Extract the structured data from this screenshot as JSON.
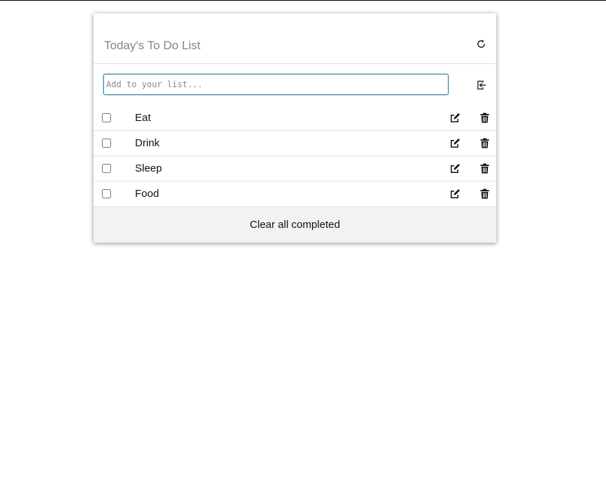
{
  "header": {
    "title": "Today's To Do List",
    "refresh_icon": "refresh-icon"
  },
  "add": {
    "placeholder": "Add to your list...",
    "value": "",
    "submit_icon": "sign-in-icon"
  },
  "items": [
    {
      "label": "Eat",
      "checked": false
    },
    {
      "label": "Drink",
      "checked": false
    },
    {
      "label": "Sleep",
      "checked": false
    },
    {
      "label": "Food",
      "checked": false
    }
  ],
  "row_icons": {
    "edit": "edit-icon",
    "delete": "trash-icon"
  },
  "footer": {
    "clear_label": "Clear all completed"
  },
  "colors": {
    "accent": "#3b8fa7",
    "title": "#858585",
    "footer_bg": "#f2f2f2",
    "divider": "#e3e3e3"
  }
}
